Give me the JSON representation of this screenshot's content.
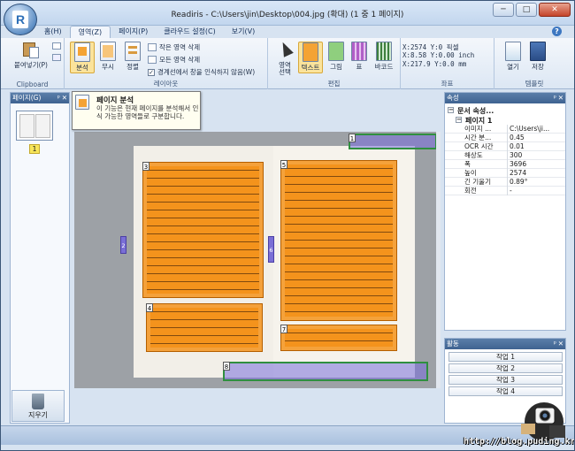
{
  "window": {
    "title": "Readiris - C:\\Users\\jin\\Desktop\\004.jpg (확대) (1 중 1 페이지)",
    "buttons": [
      "─",
      "□",
      "✕"
    ]
  },
  "ribbon_tabs": [
    "홈(H)",
    "영역(Z)",
    "페이지(P)",
    "클라우드 설정(C)",
    "보기(V)"
  ],
  "ribbon": {
    "clipboard": {
      "paste_label": "붙여넣기(P)",
      "group_label": "Clipboard"
    },
    "layout": {
      "analyze_label": "분석",
      "ignore_label": "무시",
      "align_label": "정렬",
      "delete_small_label": "작은 영역 삭제",
      "delete_all_label": "모든 영역 삭제",
      "border_checkbox_label": "경계선에서 창을 인식하지 않음(W)",
      "group_label": "레이아웃"
    },
    "edit": {
      "select_region_label": "영역\n선택",
      "text_label": "텍스트",
      "image_label": "그림",
      "table_label": "표",
      "barcode_label": "바코드",
      "group_label": "편집"
    },
    "coords": {
      "x_line": "X:2574 Y:0 픽셀",
      "x_inch": "X:8.58 Y:0.00 inch",
      "x_mm": "X:217.9 Y:0.0 mm",
      "group_label": "좌표"
    },
    "template": {
      "open_label": "열기",
      "save_label": "저장",
      "group_label": "템플릿"
    }
  },
  "left_panel": {
    "title": "페이지(G)",
    "page_number": "1"
  },
  "trash": {
    "label": "지우기"
  },
  "tooltip": {
    "title": "페이지 분석",
    "body": "이 기능은 현재 페이지를 분석해서 인식 가능한 영역들로 구분합니다."
  },
  "regions": {
    "labels": [
      "1",
      "2",
      "3",
      "4",
      "5",
      "6",
      "7",
      "8"
    ]
  },
  "properties": {
    "title": "속성",
    "doc_title": "문서 속성...",
    "page_title": "페이지 1",
    "rows": [
      {
        "k": "이미지 ...",
        "v": "C:\\Users\\ji..."
      },
      {
        "k": "시간 분...",
        "v": "0.45"
      },
      {
        "k": "OCR 시간",
        "v": "0.01"
      },
      {
        "k": "해상도",
        "v": "300"
      },
      {
        "k": "폭",
        "v": "3696"
      },
      {
        "k": "높이",
        "v": "2574"
      },
      {
        "k": "긴 기울기",
        "v": "0.89°"
      },
      {
        "k": "회전",
        "v": "-"
      }
    ]
  },
  "activity": {
    "title": "활동",
    "jobs": [
      "작업 1",
      "작업 2",
      "작업 3",
      "작업 4"
    ]
  },
  "watermark": "http://blog.puding.kr"
}
